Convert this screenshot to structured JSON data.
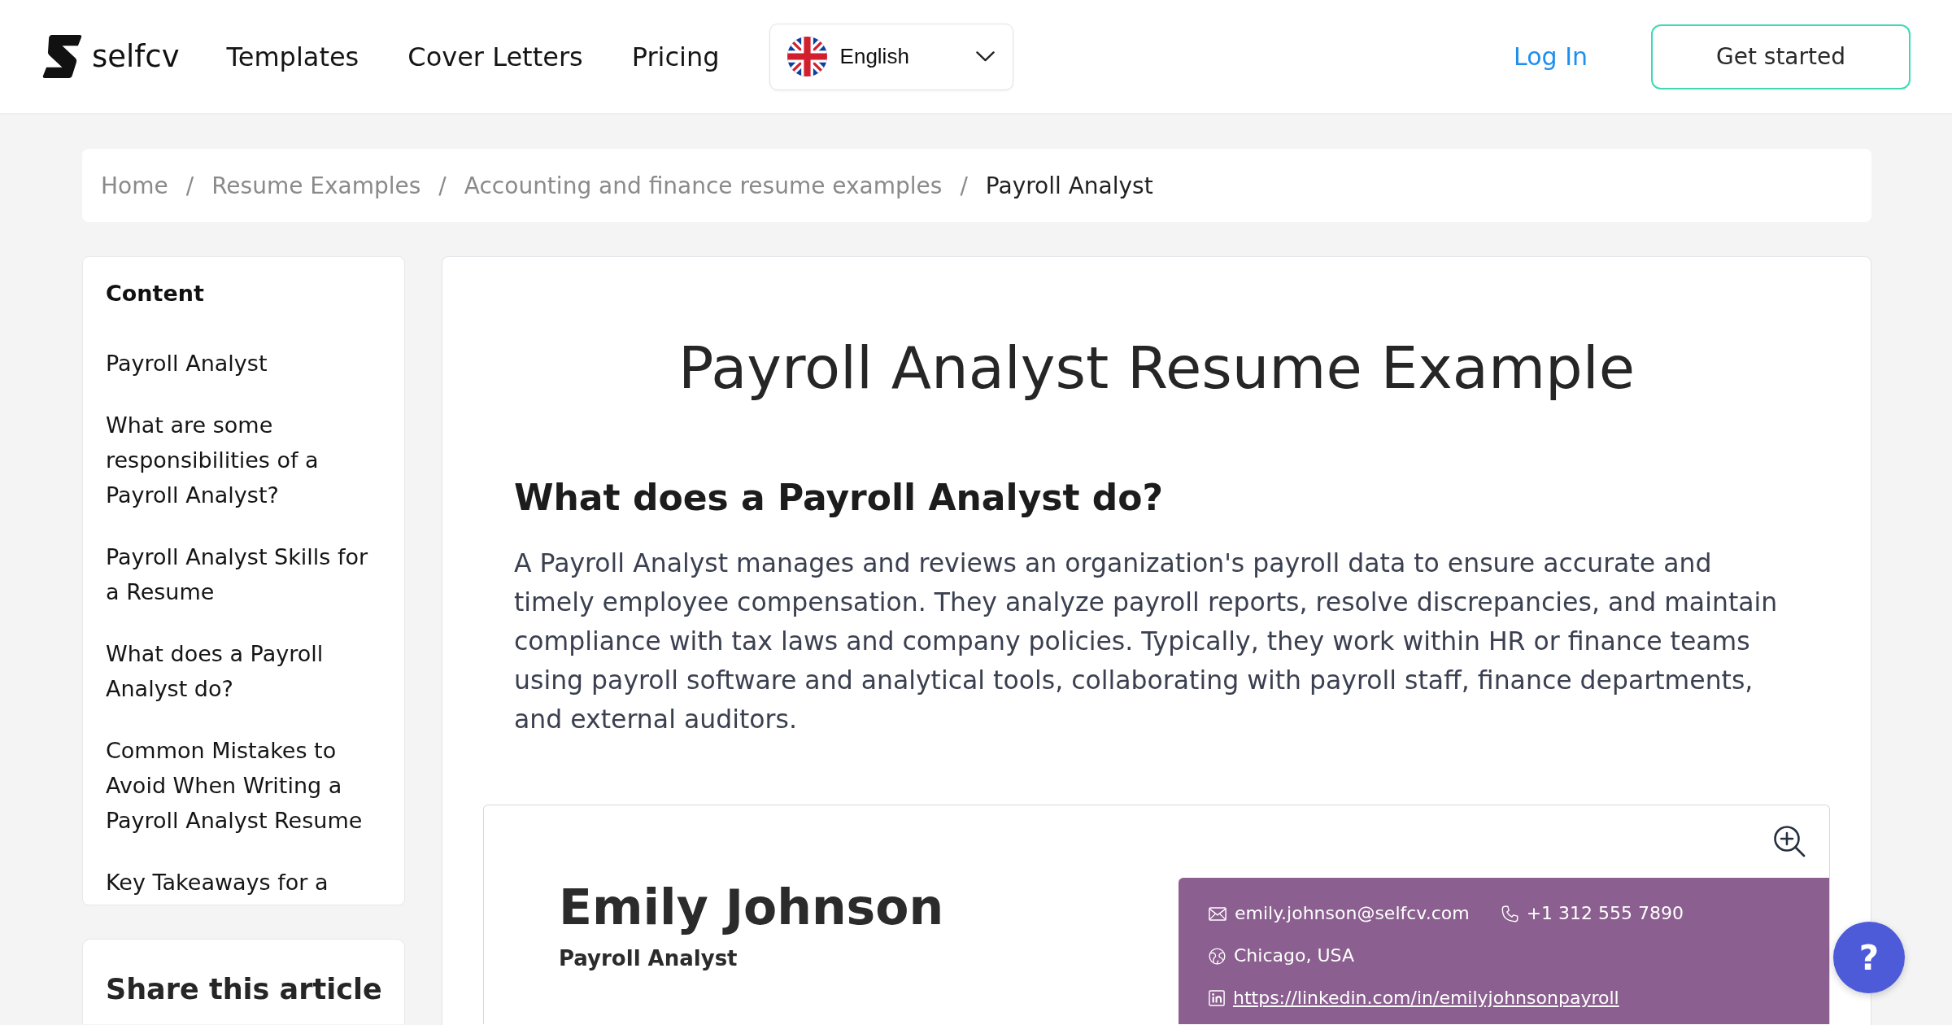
{
  "header": {
    "logo": "selfcv",
    "nav": [
      "Templates",
      "Cover Letters",
      "Pricing"
    ],
    "language": {
      "label": "English"
    },
    "login": "Log In",
    "cta": "Get started"
  },
  "breadcrumb": [
    {
      "label": "Home",
      "current": false
    },
    {
      "separator": "/",
      "label": "Resume Examples",
      "current": false
    },
    {
      "separator": "/",
      "label": "Accounting and finance resume examples",
      "current": false
    },
    {
      "separator": "/",
      "label": "Payroll Analyst",
      "current": true
    }
  ],
  "contents": {
    "title": "Content",
    "items": [
      "Payroll Analyst",
      "What are some responsibilities of a Payroll Analyst?",
      "Payroll Analyst Skills for a Resume",
      "What does a Payroll Analyst do?",
      "Common Mistakes to Avoid When Writing a Payroll Analyst Resume",
      "Key Takeaways for a"
    ]
  },
  "share": {
    "title": "Share this article"
  },
  "article": {
    "title": "Payroll Analyst Resume Example",
    "heading": "What does a Payroll Analyst do?",
    "paragraph": "A Payroll Analyst manages and reviews an organization's payroll data to ensure accurate and timely employee compensation. They analyze payroll reports, resolve discrepancies, and maintain compliance with tax laws and company policies. Typically, they work within HR or finance teams using payroll software and analytical tools, collaborating with payroll staff, finance departments, and external auditors."
  },
  "resume": {
    "name": "Emily Johnson",
    "role": "Payroll Analyst",
    "contact_rows": [
      [
        {
          "kind": "email",
          "text": "emily.johnson@selfcv.com"
        },
        {
          "kind": "phone",
          "text": "+1 312 555 7890"
        }
      ],
      [
        {
          "kind": "location",
          "text": "Chicago, USA"
        }
      ],
      [
        {
          "kind": "linkedin",
          "text": "https://linkedin.com/in/emilyjohnsonpayroll"
        }
      ]
    ]
  },
  "help": {
    "label": "?"
  }
}
